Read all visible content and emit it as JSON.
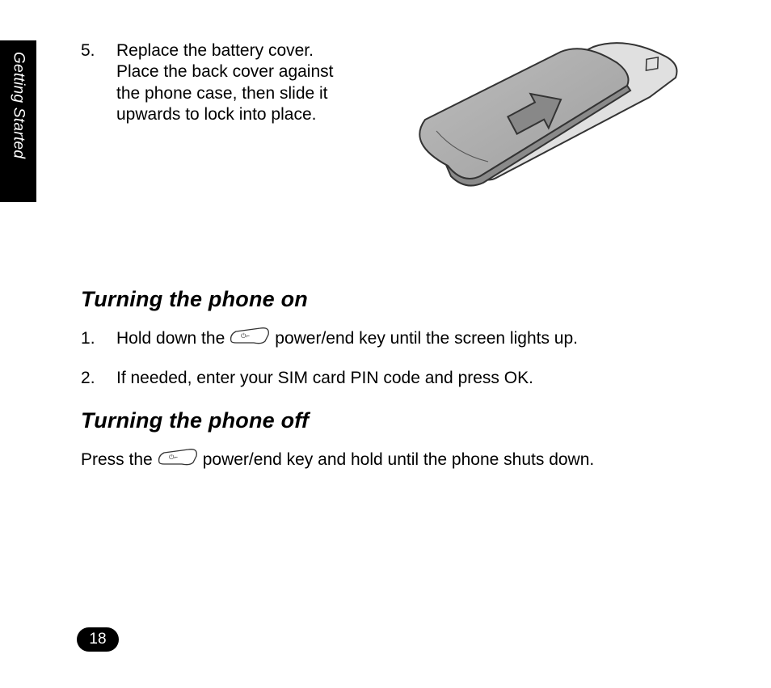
{
  "sidebar": {
    "label": "Getting Started"
  },
  "steps_top": {
    "number": "5.",
    "text": "Replace the battery cover. Place the back cover against the phone case, then slide it upwards to lock into place."
  },
  "sections": {
    "on": {
      "heading": "Turning the phone on",
      "steps": [
        {
          "pre": "Hold down the ",
          "icon": "power-end-key-icon",
          "post": " power/end key until the screen lights up."
        },
        {
          "pre": " If needed, enter your SIM card PIN code and press OK.",
          "icon": null,
          "post": ""
        }
      ]
    },
    "off": {
      "heading": "Turning the phone off",
      "body": {
        "pre": "Press the ",
        "icon": "power-end-key-icon",
        "post": " power/end key and hold until the phone shuts down."
      }
    }
  },
  "page_number": "18"
}
